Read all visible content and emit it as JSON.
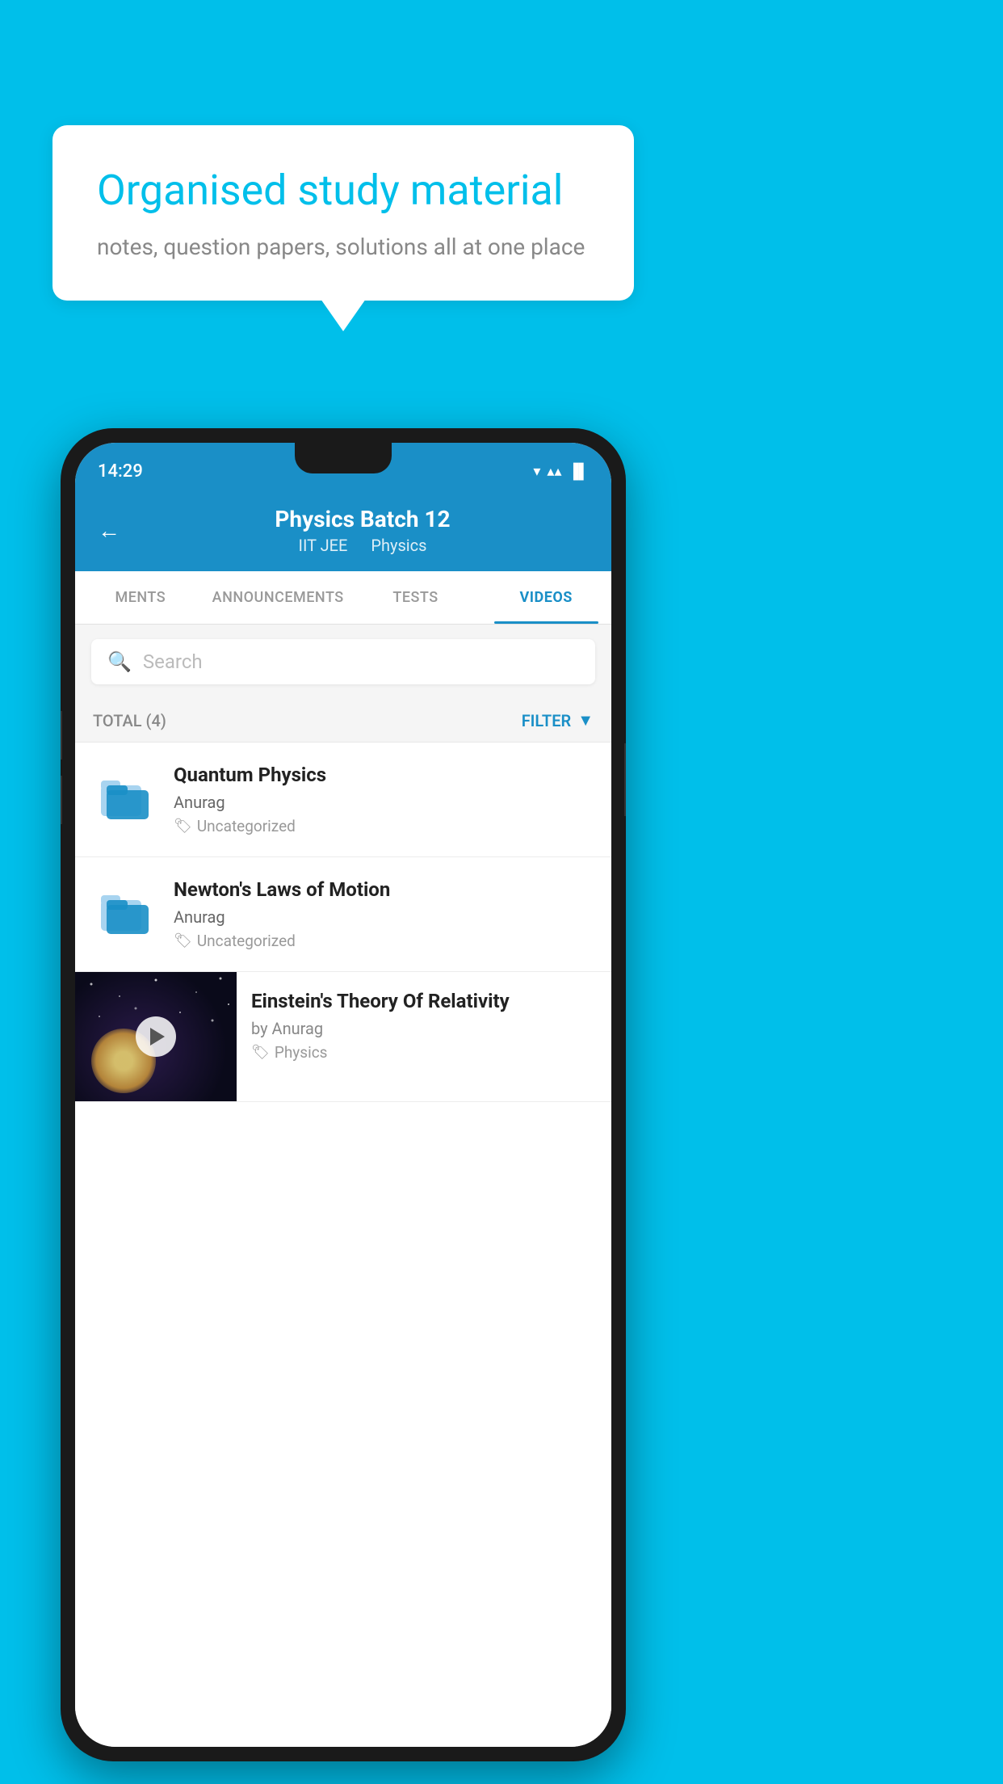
{
  "background_color": "#00BFEA",
  "speech_bubble": {
    "title": "Organised study material",
    "subtitle": "notes, question papers, solutions all at one place"
  },
  "status_bar": {
    "time": "14:29",
    "wifi": "▼",
    "signal": "▲",
    "battery": "▐"
  },
  "app_header": {
    "back_label": "←",
    "title": "Physics Batch 12",
    "subtitle_part1": "IIT JEE",
    "subtitle_part2": "Physics"
  },
  "tabs": [
    {
      "label": "MENTS",
      "active": false
    },
    {
      "label": "ANNOUNCEMENTS",
      "active": false
    },
    {
      "label": "TESTS",
      "active": false
    },
    {
      "label": "VIDEOS",
      "active": true
    }
  ],
  "search": {
    "placeholder": "Search"
  },
  "filter_bar": {
    "total_label": "TOTAL (4)",
    "filter_label": "FILTER"
  },
  "video_items": [
    {
      "id": 1,
      "title": "Quantum Physics",
      "author": "Anurag",
      "tag": "Uncategorized",
      "type": "folder"
    },
    {
      "id": 2,
      "title": "Newton's Laws of Motion",
      "author": "Anurag",
      "tag": "Uncategorized",
      "type": "folder"
    },
    {
      "id": 3,
      "title": "Einstein's Theory Of Relativity",
      "author": "by Anurag",
      "tag": "Physics",
      "type": "video"
    }
  ]
}
